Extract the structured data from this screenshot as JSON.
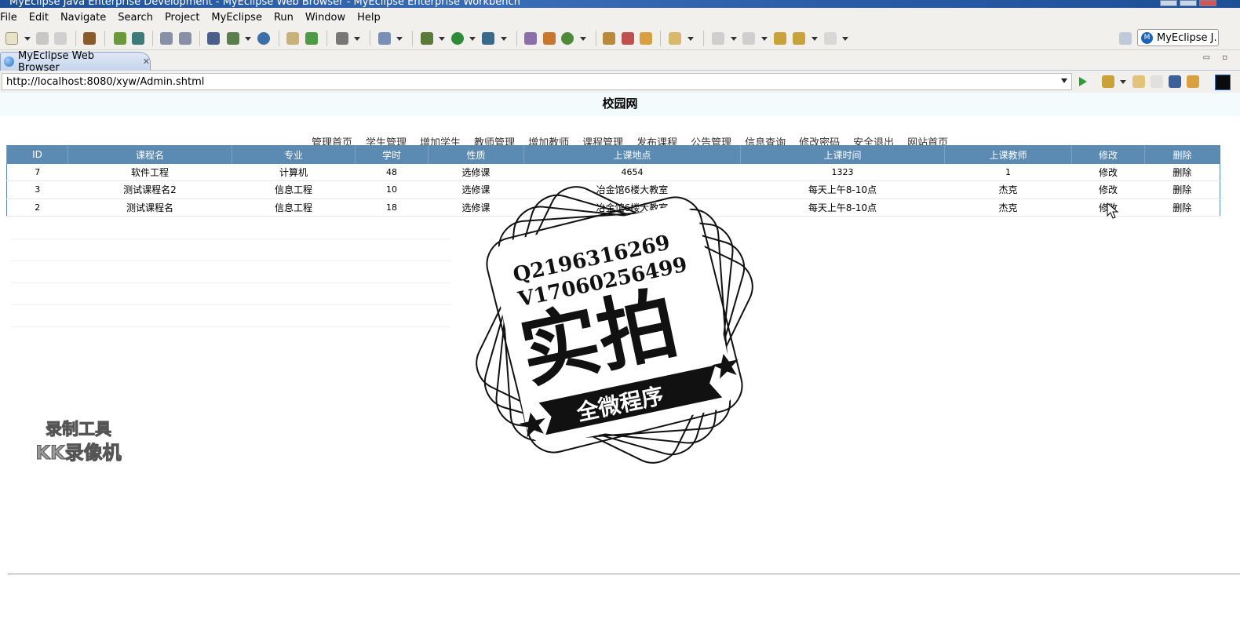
{
  "window": {
    "title": "MyEclipse Java Enterprise Development - MyEclipse Web Browser - MyEclipse Enterprise Workbench"
  },
  "menu": [
    "File",
    "Edit",
    "Navigate",
    "Search",
    "Project",
    "MyEclipse",
    "Run",
    "Window",
    "Help"
  ],
  "perspective": {
    "label": "MyEclipse J..."
  },
  "tab": {
    "label": "MyEclipse Web Browser"
  },
  "browser": {
    "url": "http://localhost:8080/xyw/Admin.shtml"
  },
  "page": {
    "title": "校园网",
    "nav": [
      "管理首页",
      "学生管理",
      "增加学生",
      "教师管理",
      "增加教师",
      "课程管理",
      "发布课程",
      "公告管理",
      "信息查询",
      "修改密码",
      "安全退出",
      "网站首页"
    ]
  },
  "table": {
    "columns": [
      "ID",
      "课程名",
      "专业",
      "学时",
      "性质",
      "上课地点",
      "上课时间",
      "上课教师",
      "修改",
      "删除"
    ],
    "rows": [
      [
        "7",
        "软件工程",
        "计算机",
        "48",
        "选修课",
        "4654",
        "1323",
        "1",
        "修改",
        "删除"
      ],
      [
        "3",
        "测试课程名2",
        "信息工程",
        "10",
        "选修课",
        "冶金馆6楼大教室",
        "每天上午8-10点",
        "杰克",
        "修改",
        "删除"
      ],
      [
        "2",
        "测试课程名",
        "信息工程",
        "18",
        "选修课",
        "冶金馆6楼大教室",
        "每天上午8-10点",
        "杰克",
        "修改",
        "删除"
      ]
    ]
  },
  "watermark": {
    "line1": "Q2196316269",
    "line2": "V17060256499",
    "main": "实拍",
    "banner": "全微程序"
  },
  "recorder": {
    "line1": "录制工具",
    "line2": "KK录像机"
  }
}
